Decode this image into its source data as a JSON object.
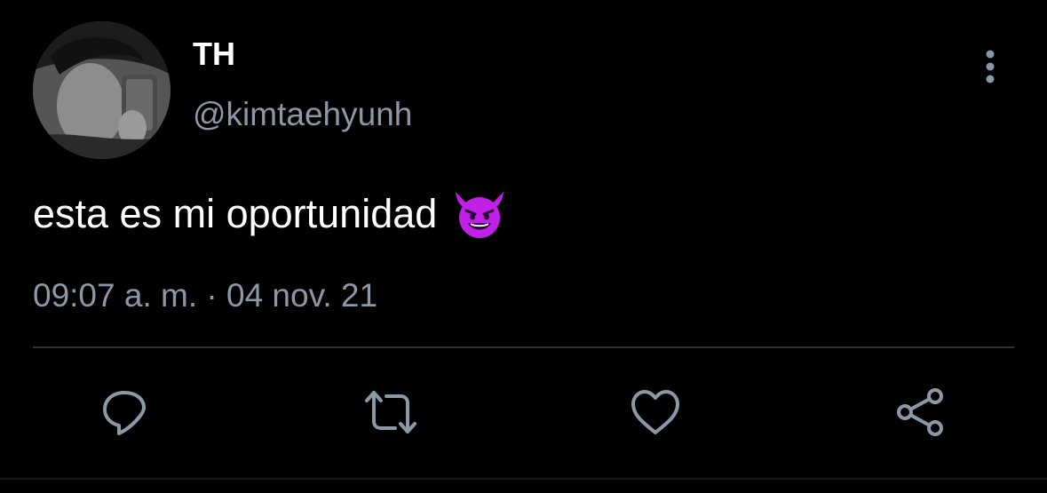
{
  "tweet": {
    "display_name": "TH",
    "handle": "@kimtaehyunh",
    "text": "esta es mi oportunidad",
    "emoji": "smiling-face-with-horns",
    "timestamp": "09:07 a. m. · 04 nov. 21"
  },
  "actions": [
    {
      "name": "reply",
      "icon": "reply-icon"
    },
    {
      "name": "retweet",
      "icon": "retweet-icon"
    },
    {
      "name": "like",
      "icon": "heart-icon"
    },
    {
      "name": "share",
      "icon": "share-icon"
    }
  ],
  "colors": {
    "background": "#000000",
    "primary_text": "#ffffff",
    "secondary_text": "#8b98a5",
    "divider": "#2f3336",
    "emoji_purple": "#c020e8"
  }
}
